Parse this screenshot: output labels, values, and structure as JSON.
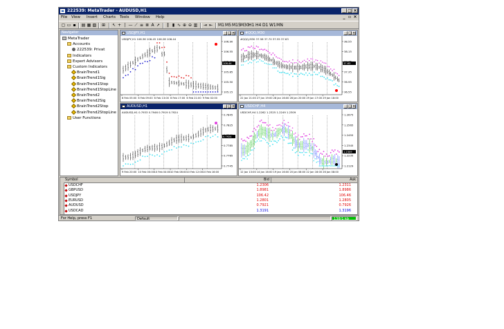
{
  "window": {
    "title": "222539: MetaTrader - AUDUSD,H1"
  },
  "menu": [
    "File",
    "View",
    "Insert",
    "Charts",
    "Tools",
    "Window",
    "Help"
  ],
  "navigator": {
    "header": "Navigator",
    "items": [
      {
        "label": "MetaTrader",
        "icon": "computer-icon",
        "indent": 0
      },
      {
        "label": "Accounts",
        "icon": "folder-icon",
        "indent": 1
      },
      {
        "label": "222539: Privat",
        "icon": "user-icon",
        "indent": 2
      },
      {
        "label": "Indicators",
        "icon": "folder-icon",
        "indent": 1
      },
      {
        "label": "Expert Advisors",
        "icon": "folder-icon",
        "indent": 1
      },
      {
        "label": "Custom Indicators",
        "icon": "folder-icon",
        "indent": 1
      },
      {
        "label": "BrainTrend1",
        "icon": "indicator-icon",
        "indent": 2
      },
      {
        "label": "BrainTrend1Sig",
        "icon": "indicator-icon",
        "indent": 2
      },
      {
        "label": "BrainTrend1Stop",
        "icon": "indicator-icon",
        "indent": 2
      },
      {
        "label": "BrainTrend1StopLine",
        "icon": "indicator-icon",
        "indent": 2
      },
      {
        "label": "BrainTrend2",
        "icon": "indicator-icon",
        "indent": 2
      },
      {
        "label": "BrainTrend2Sig",
        "icon": "indicator-icon",
        "indent": 2
      },
      {
        "label": "BrainTrend2Stop",
        "icon": "indicator-icon",
        "indent": 2
      },
      {
        "label": "BrainTrend2StopLine",
        "icon": "indicator-icon",
        "indent": 2
      },
      {
        "label": "User Functions",
        "icon": "folder-icon",
        "indent": 1
      }
    ]
  },
  "charts": [
    {
      "id": "usdjpy",
      "title": "USDJPY,H1",
      "info": "USDJPY,H1  106.36 106.45 106.28 106.44",
      "active": false,
      "y_labels": [
        "106.90",
        "106.55",
        "106.20",
        "105.85",
        "105.50",
        "105.15"
      ],
      "x_labels": [
        "6 Feb 05:00",
        "6 Feb 09:00",
        "6 Feb 13:00",
        "6 Feb 17:00",
        "6 Feb 21:00",
        "9 Feb 02:00"
      ],
      "price_marker": "106.44",
      "marker_color": "#ff0000"
    },
    {
      "id": "qqq",
      "title": "#QQQ,M30",
      "info": "#QQQ,M30  37.58 37.70 37.55 37.63",
      "active": false,
      "y_labels": [
        "38.55",
        "38.15",
        "37.75",
        "37.35",
        "36.95",
        "36.55"
      ],
      "x_labels": [
        "22 Jan 21:00",
        "27 Jan 19:00",
        "28 Jan 16:00",
        "28 Jan 20:00",
        "29 Jan 17:00",
        "29 Jan 18:00"
      ],
      "price_marker": "37.63",
      "marker_color": "#ff0000"
    },
    {
      "id": "audusd",
      "title": "AUDUSD,H1",
      "info": "AUDUSD,H1  0.7933 0.7946 0.7919 0.7924",
      "active": true,
      "y_labels": [
        "0.7845",
        "0.7825",
        "0.7805",
        "0.7785",
        "0.7765",
        "0.7745"
      ],
      "x_labels": [
        "9 Feb 20:00",
        "10 Feb 00:00",
        "10 Feb 04:00",
        "10 Feb 08:00",
        "10 Feb 12:00",
        "10 Feb 16:00"
      ],
      "price_marker": "0.7924",
      "marker_color": "#e040e0"
    },
    {
      "id": "usdchf",
      "title": "USDCHF,H4",
      "info": "USDCHF,H4  1.2262 1.2325 1.2249 1.2309",
      "active": false,
      "y_labels": [
        "1.2675",
        "1.2565",
        "1.2455",
        "1.2345",
        "1.2235",
        "1.2129"
      ],
      "x_labels": [
        "12 Jan 13:00",
        "14 Jan 16:00",
        "19 Jan 16:00",
        "20 Jan 08:00",
        "22 Jan 16:00",
        "26 Jan 08:00"
      ],
      "price_marker": "1.2309",
      "marker_color": "#000000"
    }
  ],
  "market_watch": {
    "columns": [
      "Symbol",
      "Bid",
      "Ask"
    ],
    "rows": [
      {
        "symbol": "USDCHF",
        "bid": "1.2306",
        "ask": "1.2311",
        "color": "red"
      },
      {
        "symbol": "GBPUSD",
        "bid": "1.8981",
        "ask": "1.8986",
        "color": "red"
      },
      {
        "symbol": "USDJPY",
        "bid": "106.42",
        "ask": "106.46",
        "color": "red"
      },
      {
        "symbol": "EURUSD",
        "bid": "1.2801",
        "ask": "1.2805",
        "color": "red"
      },
      {
        "symbol": "AUDUSD",
        "bid": "0.7921",
        "ask": "0.7926",
        "color": "red"
      },
      {
        "symbol": "USDCAD",
        "bid": "1.3191",
        "ask": "1.3196",
        "color": "blue"
      }
    ]
  },
  "statusbar": {
    "help": "For Help, press F1",
    "profile": "Default",
    "connection": "138/1 kb"
  }
}
